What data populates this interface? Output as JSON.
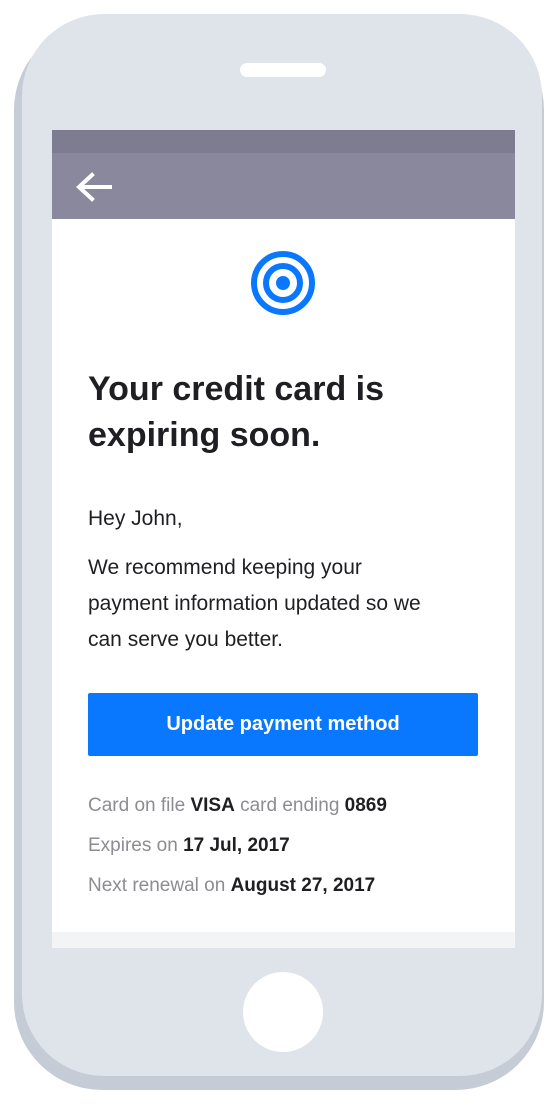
{
  "email": {
    "heading_lines": [
      "Your credit card is",
      "expiring soon."
    ],
    "greeting": "Hey John,",
    "body_lines": [
      "We recommend keeping your",
      "payment information updated so we",
      "can serve you better."
    ],
    "cta_label": "Update payment method",
    "details": {
      "card_prefix": "Card on file",
      "card_brand": "VISA",
      "card_middle": "card ending",
      "card_last4": "0869",
      "expires_prefix": "Expires on",
      "expires_date": "17 Jul, 2017",
      "renewal_prefix": "Next renewal on",
      "renewal_date": "August 27, 2017"
    }
  },
  "icons": {
    "back": "arrow-left-icon",
    "logo": "concentric-circles-logo"
  },
  "colors": {
    "accent": "#0A78FE",
    "nav_bar": "#8A889C",
    "status_bar": "#7E7C90",
    "phone_body": "#DFE3EA",
    "heading_text": "#1F1F23",
    "muted_text": "#8C8C92"
  }
}
